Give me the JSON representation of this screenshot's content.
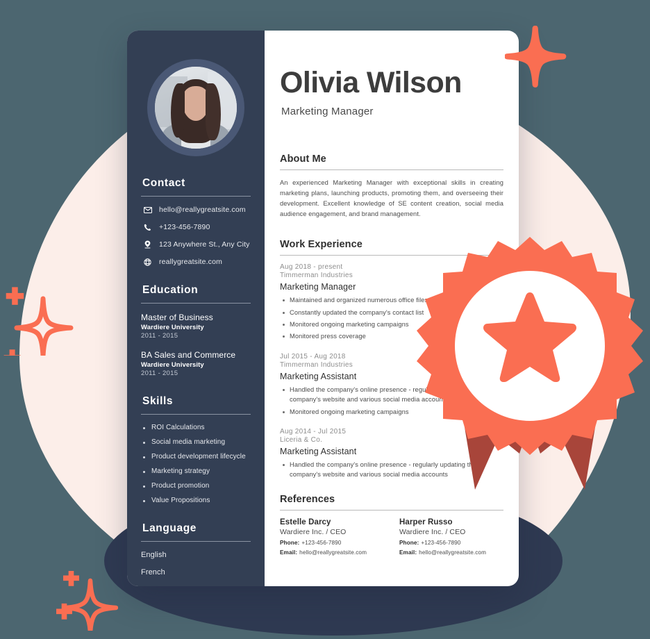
{
  "theme": {
    "page_background": "#4c6670",
    "blob_pink": "#fceee9",
    "blob_navy": "#2f3a52",
    "card_background": "#ffffff",
    "sidebar_background": "#333f54",
    "accent_coral": "#fa6e52",
    "accent_coral_dark": "#a8453a",
    "avatar_ring": "#4a5875",
    "heading_text": "#2f2f2f",
    "muted_text": "#8d8d8d"
  },
  "resume": {
    "header": {
      "name": "Olivia Wilson",
      "role": "Marketing Manager",
      "avatar_alt": "portrait-photo"
    },
    "sidebar": {
      "contact": {
        "heading": "Contact",
        "items": [
          {
            "icon": "email-icon",
            "value": "hello@reallygreatsite.com"
          },
          {
            "icon": "phone-icon",
            "value": "+123-456-7890"
          },
          {
            "icon": "location-icon",
            "value": "123 Anywhere St., Any City"
          },
          {
            "icon": "globe-icon",
            "value": "reallygreatsite.com"
          }
        ]
      },
      "education": {
        "heading": "Education",
        "items": [
          {
            "degree": "Master of Business",
            "school": "Wardiere University",
            "years": "2011 - 2015"
          },
          {
            "degree": "BA Sales and Commerce",
            "school": "Wardiere University",
            "years": "2011 - 2015"
          }
        ]
      },
      "skills": {
        "heading": "Skills",
        "items": [
          "ROI Calculations",
          "Social media marketing",
          "Product development lifecycle",
          "Marketing strategy",
          "Product promotion",
          "Value Propositions"
        ]
      },
      "language": {
        "heading": "Language",
        "items": [
          "English",
          "French"
        ]
      }
    },
    "about": {
      "heading": "About Me",
      "text": "An experienced Marketing Manager with exceptional skills in creating marketing plans, launching products, promoting them, and overseeing their development. Excellent knowledge of SE content creation, social media audience engagement, and brand management."
    },
    "work": {
      "heading": "Work Experience",
      "jobs": [
        {
          "date": "Aug 2018 - present",
          "company": "Timmerman Industries",
          "title": "Marketing Manager",
          "bullets": [
            "Maintained and organized numerous office files",
            "Constantly updated the company's contact list",
            "Monitored ongoing marketing campaigns",
            "Monitored press coverage"
          ]
        },
        {
          "date": "Jul 2015 - Aug 2018",
          "company": "Timmerman Industries",
          "title": "Marketing Assistant",
          "bullets": [
            "Handled the company's online presence - regularly updating the company's website and various social media accounts",
            "Monitored ongoing marketing campaigns"
          ]
        },
        {
          "date": "Aug 2014 - Jul 2015",
          "company": "Liceria & Co.",
          "title": "Marketing Assistant",
          "bullets": [
            "Handled the company's online presence - regularly updating the company's website and various social media accounts"
          ]
        }
      ]
    },
    "references": {
      "heading": "References",
      "phone_label": "Phone:",
      "email_label": "Email:",
      "people": [
        {
          "name": "Estelle Darcy",
          "company": "Wardiere Inc. / CEO",
          "phone": "+123-456-7890",
          "email": "hello@reallygreatsite.com"
        },
        {
          "name": "Harper Russo",
          "company": "Wardiere Inc. / CEO",
          "phone": "+123-456-7890",
          "email": "hello@reallygreatsite.com"
        }
      ]
    }
  },
  "decorations": {
    "badge": "award-ribbon-badge",
    "sparkles": [
      "four-point-star-filled",
      "four-point-star-outline",
      "four-point-star-outline"
    ]
  }
}
